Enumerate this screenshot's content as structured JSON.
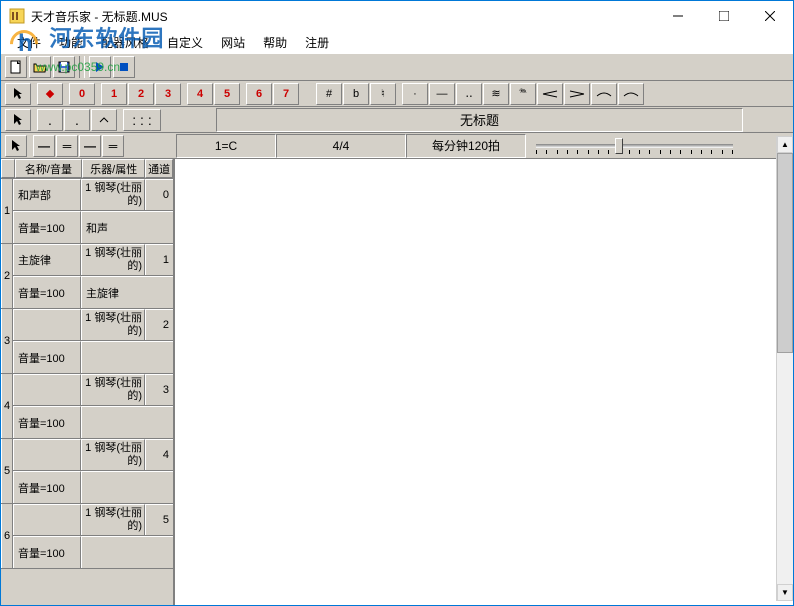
{
  "window": {
    "title": "天才音乐家 - 无标题.MUS"
  },
  "watermark": {
    "name": "河东软件园",
    "url": "www.pc0359.cn"
  },
  "menu": {
    "file": "文件",
    "func": "功能",
    "style": "配器风格",
    "custom": "自定义",
    "website": "网站",
    "help": "帮助",
    "register": "注册"
  },
  "toolbar2_nums": [
    "0",
    "1",
    "2",
    "3",
    "4",
    "5",
    "6",
    "7"
  ],
  "toolbar2_syms": [
    "#",
    "b",
    "♮",
    "·",
    "—",
    "‥",
    "≋",
    "𝆮",
    "⌒",
    "⌒",
    "⌒"
  ],
  "title_field": "无标题",
  "info": {
    "key": "1=C",
    "signature": "4/4",
    "tempo": "每分钟120拍"
  },
  "table_headers": {
    "name_vol": "名称/音量",
    "instr_prop": "乐器/属性",
    "channel": "通道"
  },
  "tracks": [
    {
      "num": "1",
      "name": "和声部",
      "instr": "1 钢琴(壮丽的)",
      "chan": "0",
      "vol": "音量=100",
      "desc": "和声"
    },
    {
      "num": "2",
      "name": "主旋律",
      "instr": "1 钢琴(壮丽的)",
      "chan": "1",
      "vol": "音量=100",
      "desc": "主旋律"
    },
    {
      "num": "3",
      "name": "",
      "instr": "1 钢琴(壮丽的)",
      "chan": "2",
      "vol": "音量=100",
      "desc": ""
    },
    {
      "num": "4",
      "name": "",
      "instr": "1 钢琴(壮丽的)",
      "chan": "3",
      "vol": "音量=100",
      "desc": ""
    },
    {
      "num": "5",
      "name": "",
      "instr": "1 钢琴(壮丽的)",
      "chan": "4",
      "vol": "音量=100",
      "desc": ""
    },
    {
      "num": "6",
      "name": "",
      "instr": "1 钢琴(壮丽的)",
      "chan": "5",
      "vol": "音量=100",
      "desc": ""
    }
  ]
}
